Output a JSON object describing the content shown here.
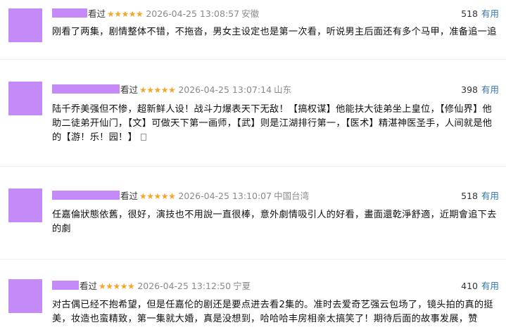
{
  "comments": [
    {
      "kanguo": "看过",
      "stars": "★★★★★",
      "time": "2026-04-25 13:08:57",
      "location": "安徽",
      "count": "518",
      "useful_label": "有用",
      "text": "刚看了两集，剧情整体不错，不拖沓，男女主设定也是第一次看，听说男主后面还有多个马甲，准备追一追"
    },
    {
      "kanguo": "看过",
      "stars": "★★★★★",
      "time": "2026-04-25 13:07:14",
      "location": "山东",
      "count": "398",
      "useful_label": "有用",
      "lines": [
        "陆千乔美强但不惨，超新鲜人设！战斗力爆表天下无敌！【搞权谋】他能扶大徒弟坐上皇位，【修仙界】他",
        "助二徒弟开仙门，【文】可做天下第一画师，【武】则是江湖排行第一，【医术】精湛神医圣手，人间就是他",
        "的【游！乐！园！】"
      ]
    },
    {
      "kanguo": "看过",
      "stars": "★★★★★",
      "time": "2026-04-25 13:10:07",
      "location": "中国台湾",
      "count": "518",
      "useful_label": "有用",
      "lines": [
        "任嘉倫狀態依舊，很好，演技也不用說一直很棒，意外劇情吸引人的好看，畫面還乾淨舒適，近期會追下去",
        "的劇"
      ]
    },
    {
      "kanguo": "看过",
      "stars": "★★★★★",
      "time": "2026-04-25 13:12:50",
      "location": "宁夏",
      "count": "410",
      "useful_label": "有用",
      "lines": [
        "对古偶已经不抱希望，但是任嘉伦的剧还是要点进去看2集的。准时去爱奇艺强云包场了，镜头拍的真的挺",
        "美，妆造也蛮精致，第一集就大婚，真是没想到，哈哈哈丰房相亲太搞笑了！期待后面的故事发展，赞"
      ]
    }
  ]
}
